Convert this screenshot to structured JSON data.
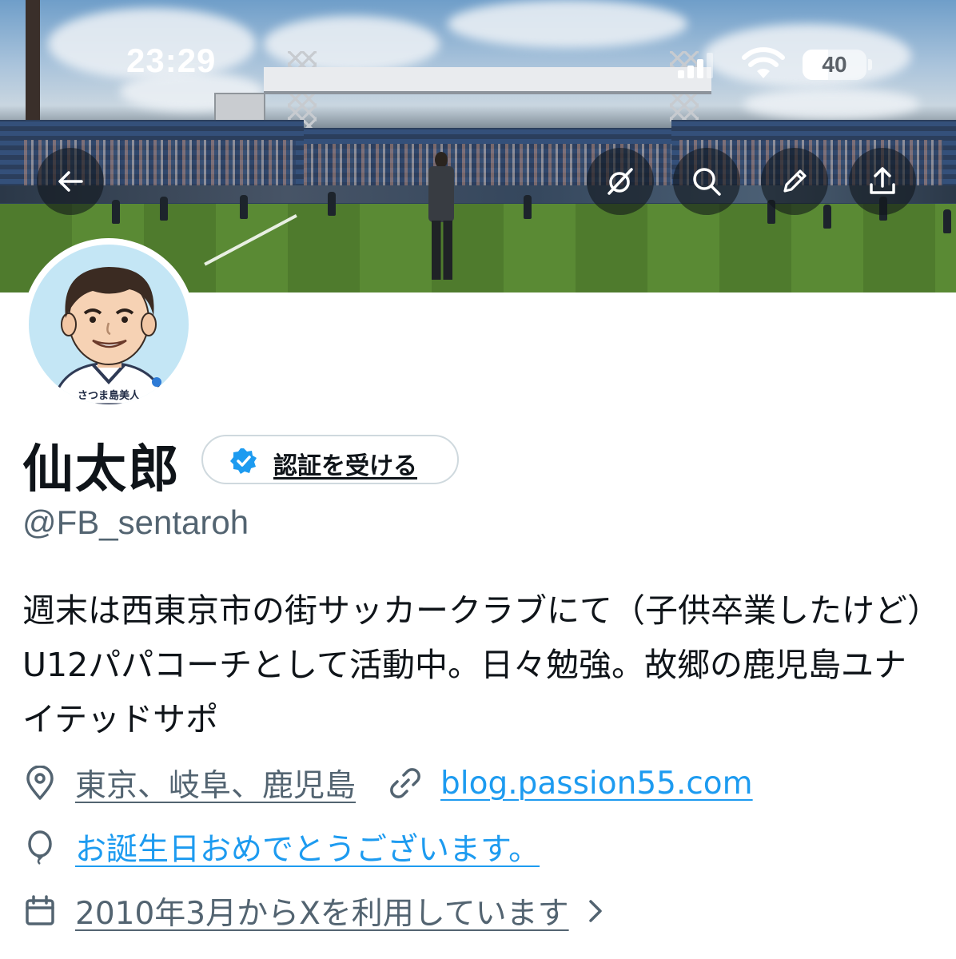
{
  "status_bar": {
    "time": "23:29",
    "battery": "40",
    "battery_fraction": 0.4
  },
  "banner_actions": {
    "back": "back-arrow-icon",
    "grok": "grok-icon",
    "search": "search-icon",
    "edit": "pencil-icon",
    "share": "share-icon"
  },
  "avatar": {
    "caption": "さつま島美人"
  },
  "profile": {
    "name": "仙太郎",
    "verify_label": "認証を受ける",
    "handle": "@FB_sentaroh",
    "bio": "週末は西東京市の街サッカークラブにて（子供卒業したけど）U12パパコーチとして活動中。日々勉強。故郷の鹿児島ユナイテッドサポ",
    "location": "東京、岐阜、鹿児島",
    "website": "blog.passion55.com",
    "birthday": "お誕生日おめでとうございます。",
    "joined": "2010年3月からXを利用しています"
  },
  "colors": {
    "accent": "#1d9bf0",
    "secondary_text": "#536471",
    "primary_text": "#0f1419"
  }
}
